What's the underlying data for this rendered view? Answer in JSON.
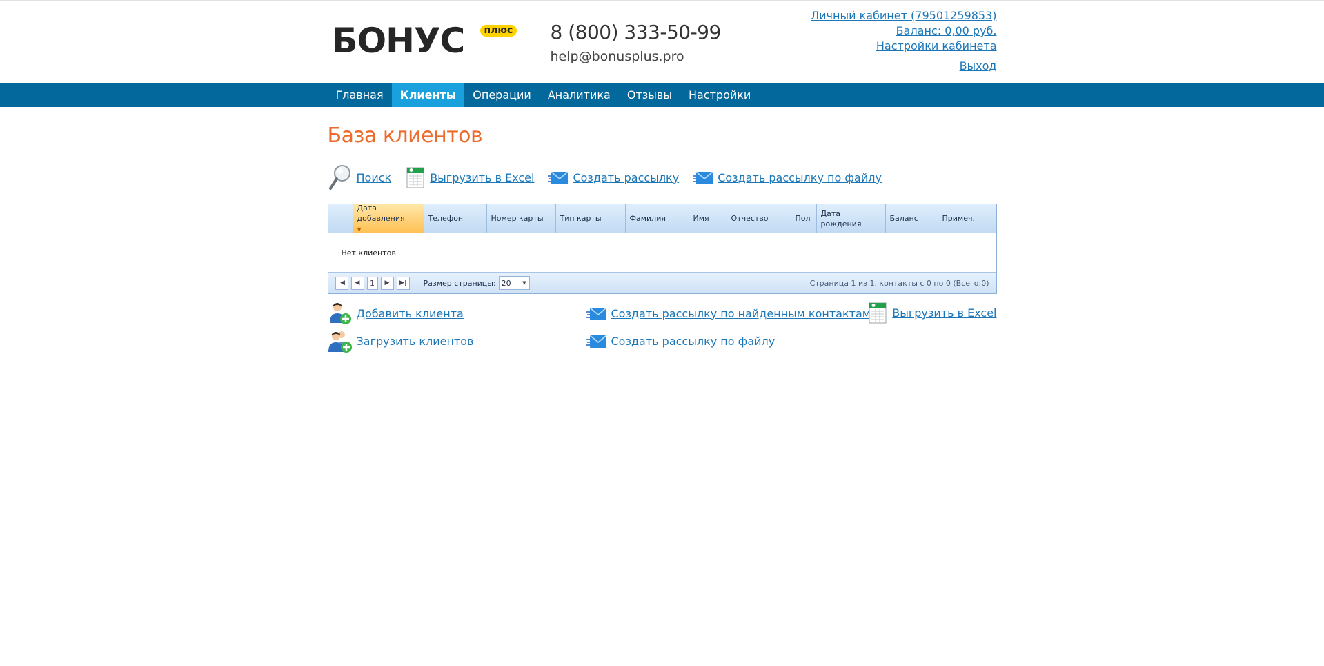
{
  "header": {
    "logo_text": "БОНУС",
    "logo_badge": "плюс",
    "phone": "8 (800) 333-50-99",
    "email": "help@bonusplus.pro",
    "account_link": "Личный кабинет (79501259853)",
    "balance_link": "Баланс: 0,00 руб.",
    "settings_link": "Настройки кабинета",
    "logout_link": "Выход"
  },
  "nav": {
    "items": [
      {
        "label": "Главная"
      },
      {
        "label": "Клиенты"
      },
      {
        "label": "Операции"
      },
      {
        "label": "Аналитика"
      },
      {
        "label": "Отзывы"
      },
      {
        "label": "Настройки"
      }
    ],
    "active": "Клиенты"
  },
  "page": {
    "title": "База клиентов"
  },
  "toolbar": {
    "search": "Поиск",
    "export_excel": "Выгрузить в Excel",
    "create_mailing": "Создать рассылку",
    "create_mailing_file": "Создать рассылку по файлу"
  },
  "grid": {
    "columns": [
      {
        "label": "Дата добавления"
      },
      {
        "label": "Телефон"
      },
      {
        "label": "Номер карты"
      },
      {
        "label": "Тип карты"
      },
      {
        "label": "Фамилия"
      },
      {
        "label": "Имя"
      },
      {
        "label": "Отчество"
      },
      {
        "label": "Пол"
      },
      {
        "label": "Дата рождения"
      },
      {
        "label": "Баланс"
      },
      {
        "label": "Примеч."
      }
    ],
    "empty_text": "Нет клиентов",
    "pager": {
      "current_page": "1",
      "page_size_label": "Размер страницы:",
      "page_size": "20",
      "info": "Страница 1 из 1, контакты с 0 по 0 (Всего:0)"
    }
  },
  "actions": {
    "add_client": "Добавить клиента",
    "upload_clients": "Загрузить клиентов",
    "mailing_found": "Создать рассылку по найденным контактам",
    "mailing_file": "Создать рассылку по файлу",
    "export_excel": "Выгрузить в Excel"
  },
  "colors": {
    "nav_bg": "#03689c",
    "nav_active": "#1aa0dc",
    "title": "#ec6a2b",
    "link": "#1b77b8",
    "logo_badge": "#ffd200"
  }
}
